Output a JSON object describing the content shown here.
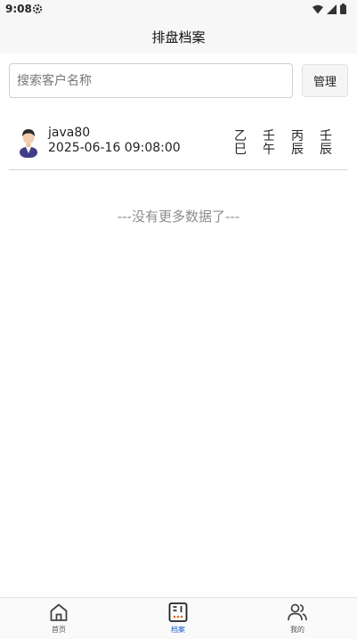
{
  "status_bar": {
    "time": "9:08",
    "icons": [
      "gear-icon",
      "wifi-icon",
      "signal-icon",
      "battery-icon"
    ]
  },
  "header": {
    "title": "排盘档案"
  },
  "search": {
    "placeholder": "搜索客户名称",
    "value": ""
  },
  "toolbar": {
    "manage_label": "管理"
  },
  "records": [
    {
      "avatar_icon": "user-avatar-icon",
      "name": "java80",
      "datetime": "2025-06-16 09:08:00",
      "pillars": [
        {
          "stem": "乙",
          "branch": "巳"
        },
        {
          "stem": "壬",
          "branch": "午"
        },
        {
          "stem": "丙",
          "branch": "辰"
        },
        {
          "stem": "壬",
          "branch": "辰"
        }
      ]
    }
  ],
  "list_footer": "---没有更多数据了---",
  "tab_bar": {
    "tabs": [
      {
        "label": "首页",
        "icon": "home-icon",
        "active": false
      },
      {
        "label": "档案",
        "icon": "archive-icon",
        "active": true
      },
      {
        "label": "我的",
        "icon": "users-icon",
        "active": false
      }
    ]
  },
  "colors": {
    "accent": "#1a5fd0",
    "tab_archive_dots": "#e8681a"
  }
}
